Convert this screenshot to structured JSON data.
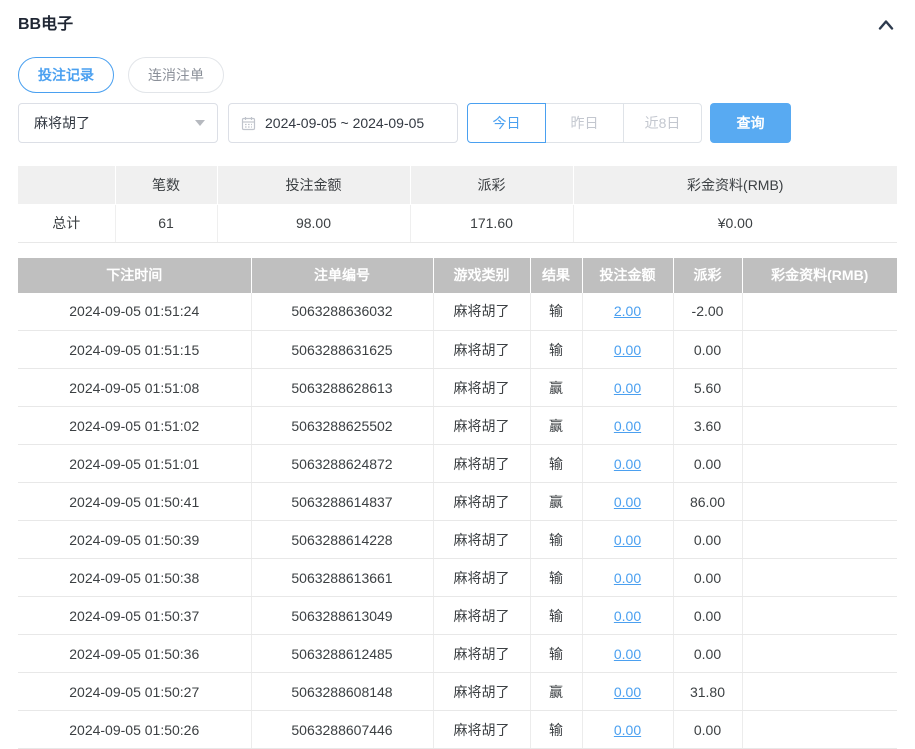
{
  "header": {
    "title": "BB电子"
  },
  "icons": {
    "collapse": "chevron-up-icon",
    "date": "calendar-icon",
    "select": "chevron-down-icon"
  },
  "tabs": [
    {
      "label": "投注记录",
      "active": true
    },
    {
      "label": "连消注单",
      "active": false
    }
  ],
  "filters": {
    "game_select": {
      "value": "麻将胡了"
    },
    "date_range": {
      "value": "2024-09-05 ~ 2024-09-05"
    },
    "quick_ranges": [
      {
        "label": "今日",
        "active": true
      },
      {
        "label": "昨日",
        "active": false
      },
      {
        "label": "近8日",
        "active": false
      }
    ],
    "search_label": "查询"
  },
  "summary": {
    "columns": [
      "",
      "笔数",
      "投注金额",
      "派彩",
      "彩金资料(RMB)"
    ],
    "total": {
      "label": "总计",
      "count": "61",
      "bet_amount": "98.00",
      "payout": "171.60",
      "bonus": "¥0.00"
    }
  },
  "table": {
    "columns": [
      "下注时间",
      "注单编号",
      "游戏类别",
      "结果",
      "投注金额",
      "派彩",
      "彩金资料(RMB)"
    ],
    "rows": [
      {
        "time": "2024-09-05 01:51:24",
        "order_id": "5063288636032",
        "game": "麻将胡了",
        "result": "输",
        "bet": "2.00",
        "payout": "-2.00",
        "negative": true,
        "bonus": ""
      },
      {
        "time": "2024-09-05 01:51:15",
        "order_id": "5063288631625",
        "game": "麻将胡了",
        "result": "输",
        "bet": "0.00",
        "payout": "0.00",
        "negative": false,
        "bonus": ""
      },
      {
        "time": "2024-09-05 01:51:08",
        "order_id": "5063288628613",
        "game": "麻将胡了",
        "result": "赢",
        "bet": "0.00",
        "payout": "5.60",
        "negative": false,
        "bonus": ""
      },
      {
        "time": "2024-09-05 01:51:02",
        "order_id": "5063288625502",
        "game": "麻将胡了",
        "result": "赢",
        "bet": "0.00",
        "payout": "3.60",
        "negative": false,
        "bonus": ""
      },
      {
        "time": "2024-09-05 01:51:01",
        "order_id": "5063288624872",
        "game": "麻将胡了",
        "result": "输",
        "bet": "0.00",
        "payout": "0.00",
        "negative": false,
        "bonus": ""
      },
      {
        "time": "2024-09-05 01:50:41",
        "order_id": "5063288614837",
        "game": "麻将胡了",
        "result": "赢",
        "bet": "0.00",
        "payout": "86.00",
        "negative": false,
        "bonus": ""
      },
      {
        "time": "2024-09-05 01:50:39",
        "order_id": "5063288614228",
        "game": "麻将胡了",
        "result": "输",
        "bet": "0.00",
        "payout": "0.00",
        "negative": false,
        "bonus": ""
      },
      {
        "time": "2024-09-05 01:50:38",
        "order_id": "5063288613661",
        "game": "麻将胡了",
        "result": "输",
        "bet": "0.00",
        "payout": "0.00",
        "negative": false,
        "bonus": ""
      },
      {
        "time": "2024-09-05 01:50:37",
        "order_id": "5063288613049",
        "game": "麻将胡了",
        "result": "输",
        "bet": "0.00",
        "payout": "0.00",
        "negative": false,
        "bonus": ""
      },
      {
        "time": "2024-09-05 01:50:36",
        "order_id": "5063288612485",
        "game": "麻将胡了",
        "result": "输",
        "bet": "0.00",
        "payout": "0.00",
        "negative": false,
        "bonus": ""
      },
      {
        "time": "2024-09-05 01:50:27",
        "order_id": "5063288608148",
        "game": "麻将胡了",
        "result": "赢",
        "bet": "0.00",
        "payout": "31.80",
        "negative": false,
        "bonus": ""
      },
      {
        "time": "2024-09-05 01:50:26",
        "order_id": "5063288607446",
        "game": "麻将胡了",
        "result": "输",
        "bet": "0.00",
        "payout": "0.00",
        "negative": false,
        "bonus": ""
      }
    ]
  },
  "colors": {
    "accent": "#4aa0f0",
    "accent_fill": "#58aaf2",
    "link": "#4ba0f0",
    "negative": "#f15656",
    "records_header_bg": "#bfbfbf",
    "summary_header_bg": "#f0f0f0"
  }
}
